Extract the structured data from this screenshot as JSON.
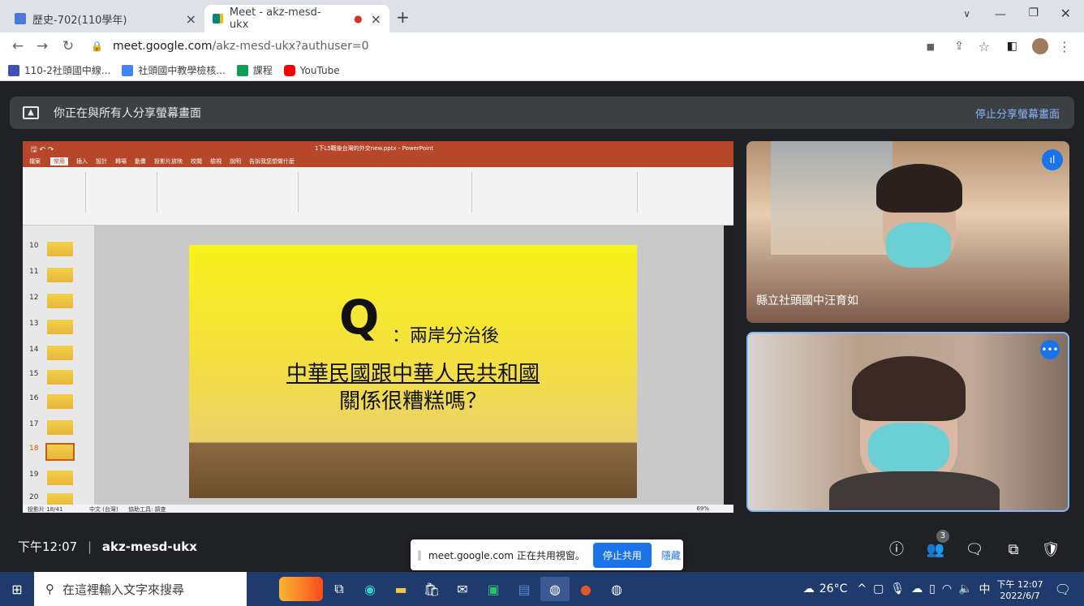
{
  "browser": {
    "tabs": [
      {
        "label": "歷史-702(110學年)",
        "close": "×"
      },
      {
        "label": "Meet - akz-mesd-ukx",
        "close": "×",
        "recording": "●"
      }
    ],
    "new_tab": "+",
    "url_host": "meet.google.com",
    "url_path": "/akz-mesd-ukx?authuser=0",
    "bookmarks": [
      {
        "label": "110-2社頭國中線...",
        "color": "#3f51b5"
      },
      {
        "label": "社頭國中教學檢核...",
        "color": "#4285f4"
      },
      {
        "label": "課程",
        "color": "#0f9d58"
      },
      {
        "label": "YouTube",
        "color": "#ff0000"
      }
    ]
  },
  "meet": {
    "share_message": "你正在與所有人分享螢幕畫面",
    "stop_share_link": "停止分享螢幕畫面",
    "time": "下午12:07",
    "meeting_code": "akz-mesd-ukx",
    "participants_count": "3",
    "participant1_name": "縣立社頭國中汪育如"
  },
  "ppt": {
    "title_bar": "1下L5戰後台灣的外交new.pptx - PowerPoint",
    "tabs": [
      "檔案",
      "常用",
      "插入",
      "設計",
      "轉場",
      "動畫",
      "投影片放映",
      "校閱",
      "檢視",
      "說明",
      "告訴我您想做什麼"
    ],
    "thumbs": [
      {
        "num": "10",
        "selected": false
      },
      {
        "num": "11",
        "selected": false
      },
      {
        "num": "12",
        "selected": false
      },
      {
        "num": "13",
        "selected": false
      },
      {
        "num": "14",
        "selected": false
      },
      {
        "num": "15",
        "selected": false
      },
      {
        "num": "16",
        "selected": false
      },
      {
        "num": "17",
        "selected": false
      },
      {
        "num": "18",
        "selected": true
      },
      {
        "num": "19",
        "selected": false
      },
      {
        "num": "20",
        "selected": false
      }
    ],
    "status_left": "投影片 18/41",
    "status_lang": "中文 (台灣)",
    "status_access": "協助工具: 調查",
    "status_zoom": "69%",
    "slide": {
      "q_letter": "Q",
      "q_text": "：兩岸分治後",
      "line1": "中華民國跟中華人民共和國",
      "line2": "關係很糟糕嗎？"
    }
  },
  "popup": {
    "message": "meet.google.com 正在共用視窗。",
    "stop_button": "停止共用",
    "hide_link": "隱藏"
  },
  "taskbar": {
    "search_placeholder": "在這裡輸入文字來搜尋",
    "weather": "26°C",
    "ime": "中",
    "clock_time": "下午 12:07",
    "clock_date": "2022/6/7"
  }
}
